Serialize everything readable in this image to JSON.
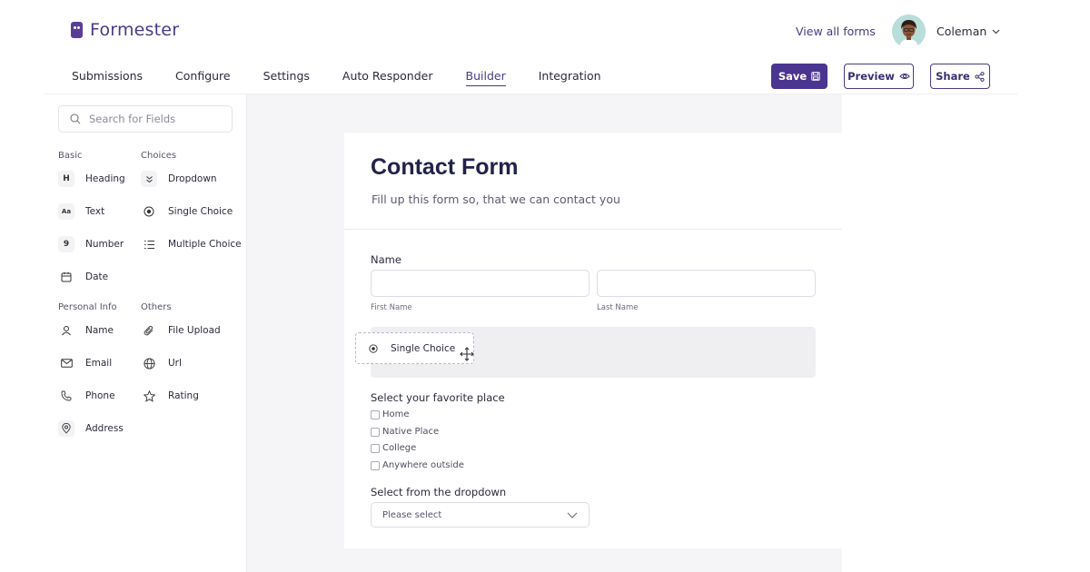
{
  "app": {
    "name": "Formester"
  },
  "header": {
    "view_all_forms": "View all forms",
    "user_name": "Coleman"
  },
  "nav": {
    "tabs": [
      {
        "label": "Submissions"
      },
      {
        "label": "Configure"
      },
      {
        "label": "Settings"
      },
      {
        "label": "Auto Responder"
      },
      {
        "label": "Builder",
        "active": true
      },
      {
        "label": "Integration"
      }
    ]
  },
  "actions": {
    "save": "Save",
    "preview": "Preview",
    "share": "Share"
  },
  "colors": {
    "brand": "#4a3590",
    "canvas": "#f5f5f8",
    "accent_text": "#4a3a86"
  },
  "sidebar": {
    "search_placeholder": "Search for Fields",
    "sections": {
      "basic": "Basic",
      "choices": "Choices",
      "personal_info": "Personal Info",
      "others": "Others"
    },
    "basic_fields": [
      {
        "label": "Heading",
        "icon": "heading-icon"
      },
      {
        "label": "Text",
        "icon": "text-icon"
      },
      {
        "label": "Number",
        "icon": "number-icon"
      },
      {
        "label": "Date",
        "icon": "calendar-icon"
      }
    ],
    "choice_fields": [
      {
        "label": "Dropdown",
        "icon": "dropdown-icon"
      },
      {
        "label": "Single Choice",
        "icon": "radio-icon"
      },
      {
        "label": "Multiple Choice",
        "icon": "checklist-icon"
      }
    ],
    "personal_fields": [
      {
        "label": "Name",
        "icon": "user-icon"
      },
      {
        "label": "Email",
        "icon": "mail-icon"
      },
      {
        "label": "Phone",
        "icon": "phone-icon"
      },
      {
        "label": "Address",
        "icon": "location-icon"
      }
    ],
    "other_fields": [
      {
        "label": "File Upload",
        "icon": "paperclip-icon"
      },
      {
        "label": "Url",
        "icon": "globe-icon"
      },
      {
        "label": "Rating",
        "icon": "star-icon"
      }
    ]
  },
  "form": {
    "title": "Contact Form",
    "subtitle": "Fill up this form so, that we can contact you",
    "name_field": {
      "label": "Name",
      "first_hint": "First Name",
      "last_hint": "Last Name"
    },
    "dragging_field": {
      "label": "Single Choice",
      "icon": "radio-icon"
    },
    "checkbox_field": {
      "label": "Select your favorite place",
      "options": [
        "Home",
        "Native Place",
        "College",
        "Anywhere outside"
      ]
    },
    "dropdown_field": {
      "label": "Select from the dropdown",
      "placeholder": "Please select"
    }
  }
}
